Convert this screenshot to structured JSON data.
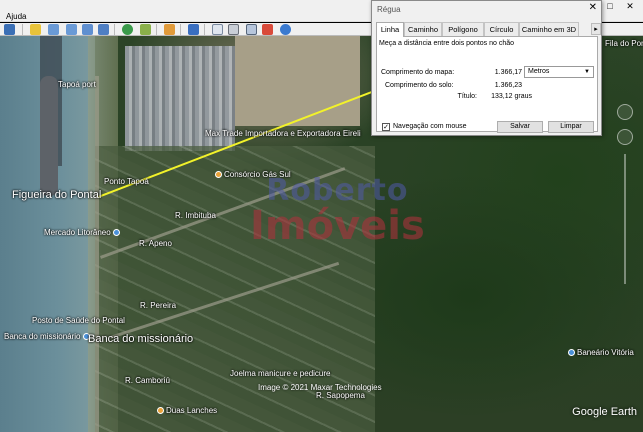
{
  "app": {
    "menu": {
      "help": "Ajuda"
    },
    "window_controls": {
      "minimize": "–",
      "restore": "□",
      "close": "✕"
    }
  },
  "toolbar": {
    "icons": [
      "sidebar-icon",
      "placemark-icon",
      "polygon-icon",
      "path-icon",
      "overlay-icon",
      "tour-icon",
      "sky-icon",
      "sun-icon",
      "history-icon",
      "ruler-icon",
      "email-icon",
      "print-icon",
      "image-icon",
      "maps-icon",
      "globe-icon"
    ]
  },
  "ruler_dialog": {
    "title": "Régua",
    "close": "✕",
    "tabs": [
      "Linha",
      "Caminho",
      "Polígono",
      "Círculo",
      "Caminho em 3D"
    ],
    "tabs_more": "▸",
    "active_tab": "Linha",
    "description": "Meça a distância entre dois pontos no chão",
    "map_length_label": "Comprimento do mapa:",
    "map_length_value": "1.366,17",
    "unit": "Metros",
    "ground_length_label": "Comprimento do solo:",
    "ground_length_value": "1.366,23",
    "heading_label": "Título:",
    "heading_value": "133,12 graus",
    "mouse_nav_label": "Navegação com mouse",
    "mouse_nav_checked": "✓",
    "save_label": "Salvar",
    "clear_label": "Limpar"
  },
  "map": {
    "labels": {
      "fila_do_ponto": "Fila do Pont",
      "tapoa_port": "Tapoá port",
      "nova_tapoa": "Ponto Tapoá",
      "figueira": "Figueira do Pontal",
      "mercado": "Mercado Litorâneo",
      "rua_apeno": "R. Apeno",
      "rua_imbituba": "R. Imbituba",
      "consorcio": "Consórcio Gás Sul",
      "max_trade": "Max Trade Importadora e Exportadora Eireli",
      "rua_pereira": "R. Pereira",
      "posto_saude": "Posto de Saúde do Pontal",
      "banca_small": "Banca do missionário",
      "banca_big": "Banca do missionário",
      "rua_camboriu": "R. Camboriú",
      "joelma": "Joelma manicure e pedicure",
      "baneario": "Baneário Vitória",
      "lanches": "Duas Lanches",
      "rua_sapopema": "R. Sapopema"
    },
    "watermark": {
      "line1": "Roberto",
      "line2": "Imóveis"
    },
    "copyright": "Image © 2021 Maxar Technologies",
    "brand": "Google Earth"
  }
}
